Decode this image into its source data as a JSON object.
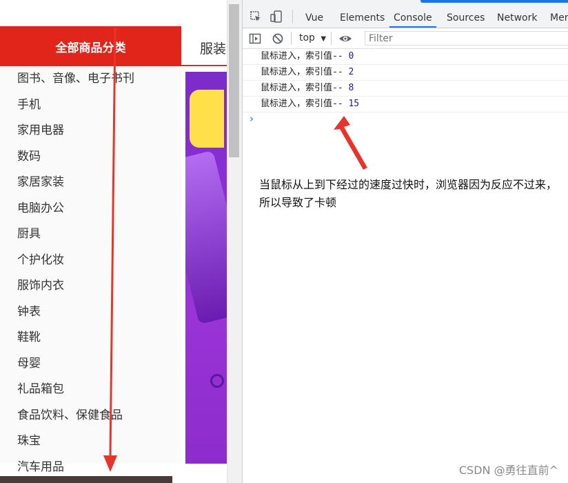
{
  "page": {
    "all_categories_label": "全部商品分类",
    "next_nav_label": "服装",
    "categories": [
      "图书、音像、电子书刊",
      "手机",
      "家用电器",
      "数码",
      "家居家装",
      "电脑办公",
      "厨具",
      "个护化妆",
      "服饰内衣",
      "钟表",
      "鞋靴",
      "母婴",
      "礼品箱包",
      "食品饮料、保健食品",
      "珠宝",
      "汽车用品"
    ],
    "accent_color": "#e1251b"
  },
  "devtools": {
    "tabs": [
      "Vue",
      "Elements",
      "Console",
      "Sources",
      "Network",
      "Mem"
    ],
    "active_tab": "Console",
    "context": "top",
    "filter_placeholder": "Filter",
    "logs": [
      {
        "text": "鼠标进入，索引值-- ",
        "value": "0"
      },
      {
        "text": "鼠标进入，索引值-- ",
        "value": "2"
      },
      {
        "text": "鼠标进入，索引值-- ",
        "value": "8"
      },
      {
        "text": "鼠标进入，索引值-- ",
        "value": "15"
      }
    ],
    "prompt_symbol": "›",
    "annotation": "当鼠标从上到下经过的速度过快时，浏览器因为反应不过来，所以导致了卡顿"
  },
  "watermark": "CSDN @勇往直前^"
}
